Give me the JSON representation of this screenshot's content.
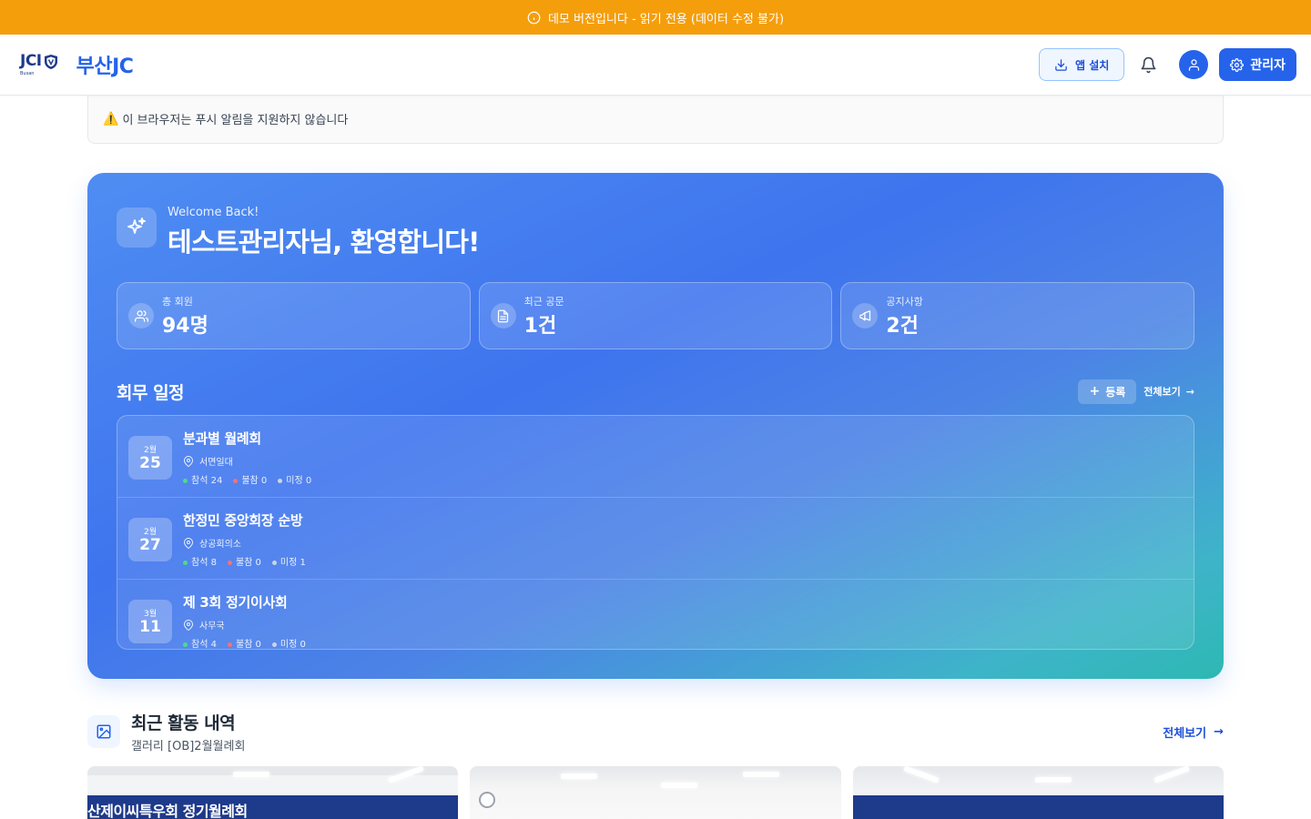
{
  "banner": {
    "text": "데모 버전입니다 - 읽기 전용 (데이터 수정 불가)"
  },
  "header": {
    "logo_jci": "JCI",
    "logo_sub": "Busan",
    "org_name": "부산JC",
    "install_label": "앱 설치",
    "admin_label": "관리자"
  },
  "push_notice": {
    "text": "이 브라우저는 푸시 알림을 지원하지 않습니다"
  },
  "hero": {
    "subtitle": "Welcome Back!",
    "title": "테스트관리자님, 환영합니다!"
  },
  "stats": [
    {
      "label": "총 회원",
      "value": "94명",
      "icon": "users-icon"
    },
    {
      "label": "최근 공문",
      "value": "1건",
      "icon": "document-icon"
    },
    {
      "label": "공지사항",
      "value": "2건",
      "icon": "megaphone-icon"
    }
  ],
  "schedule": {
    "title": "회무 일정",
    "register_label": "등록",
    "view_all_label": "전체보기",
    "events": [
      {
        "month": "2월",
        "day": "25",
        "title": "분과별 월례회",
        "location": "서면일대",
        "attend": "참석 24",
        "absent": "불참 0",
        "undecided": "미정 0"
      },
      {
        "month": "2월",
        "day": "27",
        "title": "한정민 중앙회장 순방",
        "location": "상공회의소",
        "attend": "참석 8",
        "absent": "불참 0",
        "undecided": "미정 1"
      },
      {
        "month": "3월",
        "day": "11",
        "title": "제 3회 정기이사회",
        "location": "사무국",
        "attend": "참석 4",
        "absent": "불참 0",
        "undecided": "미정 0"
      }
    ]
  },
  "recent": {
    "title": "최근 활동 내역",
    "subtitle": "갤러리 [OB]2월월례회",
    "view_all_label": "전체보기"
  },
  "gallery": {
    "photo1_banner": "산제이씨특우회 정기월례회"
  },
  "colors": {
    "banner": "#f59e0b",
    "primary": "#2563eb",
    "attend_dot": "#4ade80",
    "absent_dot": "#f87171",
    "undecided_dot": "#cbd5e1"
  }
}
